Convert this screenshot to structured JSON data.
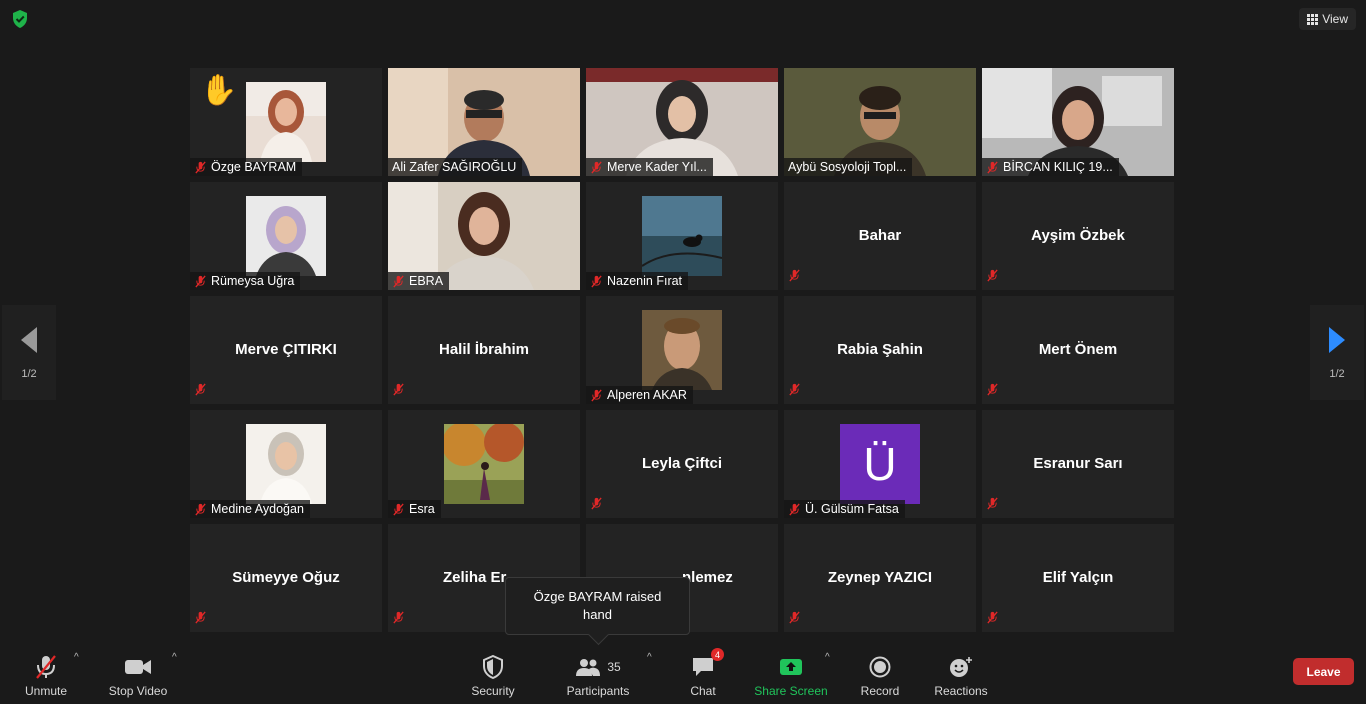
{
  "top": {
    "view_label": "View"
  },
  "pager": {
    "current": "1/2"
  },
  "tiles": [
    {
      "name": "Özge BAYRAM",
      "type": "small-video"
    },
    {
      "name": "Ali Zafer SAĞIROĞLU",
      "type": "video"
    },
    {
      "name": "Merve Kader Yıl...",
      "type": "video"
    },
    {
      "name": "Aybü Sosyoloji Topl...",
      "type": "video"
    },
    {
      "name": "BİRCAN KILIÇ 19...",
      "type": "video"
    },
    {
      "name": "Rümeysa Uğra",
      "type": "thumb"
    },
    {
      "name": "EBRA",
      "type": "video"
    },
    {
      "name": "Nazenin Fırat",
      "type": "thumb"
    },
    {
      "name": "Bahar",
      "type": "name"
    },
    {
      "name": "Ayşim Özbek",
      "type": "name"
    },
    {
      "name": "Merve ÇITIRKI",
      "type": "name"
    },
    {
      "name": "Halil İbrahim",
      "type": "name"
    },
    {
      "name": "Alperen AKAR",
      "type": "thumb"
    },
    {
      "name": "Rabia Şahin",
      "type": "name"
    },
    {
      "name": "Mert Önem",
      "type": "name"
    },
    {
      "name": "Medine Aydoğan",
      "type": "thumb"
    },
    {
      "name": "Esra",
      "type": "thumb"
    },
    {
      "name": "Leyla Çiftci",
      "type": "name"
    },
    {
      "name": "Ü. Gülsüm Fatsa",
      "type": "avatar",
      "avatar_letter": "Ü"
    },
    {
      "name": "Esranur Sarı",
      "type": "name"
    },
    {
      "name": "Sümeyye Oğuz",
      "type": "name"
    },
    {
      "name": "Zeliha Er",
      "type": "name"
    },
    {
      "name": "nlemez",
      "type": "name"
    },
    {
      "name": "Zeynep YAZICI",
      "type": "name"
    },
    {
      "name": "Elif Yalçın",
      "type": "name"
    }
  ],
  "tooltip": {
    "text": "Özge BAYRAM raised hand"
  },
  "toolbar": {
    "unmute": "Unmute",
    "stop_video": "Stop Video",
    "security": "Security",
    "participants": "Participants",
    "participants_count": "35",
    "chat": "Chat",
    "chat_badge": "4",
    "share_screen": "Share Screen",
    "record": "Record",
    "reactions": "Reactions",
    "leave": "Leave"
  },
  "colors": {
    "accent_share": "#20c45b",
    "leave": "#c12d2d",
    "active_speaker": "#d6ee6f",
    "muted_red": "#e02828"
  }
}
